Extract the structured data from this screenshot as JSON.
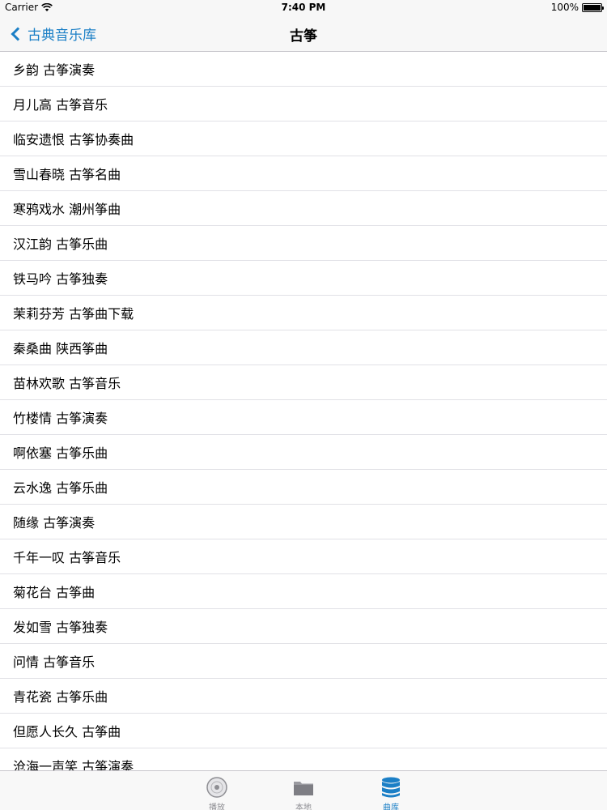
{
  "status_bar": {
    "carrier": "Carrier",
    "time": "7:40 PM",
    "battery": "100%"
  },
  "nav": {
    "back_label": "古典音乐库",
    "title": "古筝"
  },
  "songs": [
    "乡韵 古筝演奏",
    "月儿高 古筝音乐",
    "临安遗恨 古筝协奏曲",
    "雪山春晓 古筝名曲",
    "寒鸦戏水 潮州筝曲",
    "汉江韵 古筝乐曲",
    "铁马吟 古筝独奏",
    "茉莉芬芳 古筝曲下载",
    "秦桑曲 陕西筝曲",
    "苗林欢歌 古筝音乐",
    "竹楼情 古筝演奏",
    "啊依塞 古筝乐曲",
    "云水逸 古筝乐曲",
    "随缘 古筝演奏",
    "千年一叹 古筝音乐",
    "菊花台 古筝曲",
    "发如雪 古筝独奏",
    "问情 古筝音乐",
    "青花瓷 古筝乐曲",
    "但愿人长久 古筝曲",
    "沧海一声笑 古筝演奏"
  ],
  "tabs": [
    {
      "label": "播放",
      "icon": "disc-icon",
      "active": false
    },
    {
      "label": "本地",
      "icon": "folder-icon",
      "active": false
    },
    {
      "label": "曲库",
      "icon": "database-icon",
      "active": true
    }
  ],
  "colors": {
    "accent": "#1b7fc6",
    "inactive": "#8e8e93",
    "separator": "#e1e1e6"
  }
}
